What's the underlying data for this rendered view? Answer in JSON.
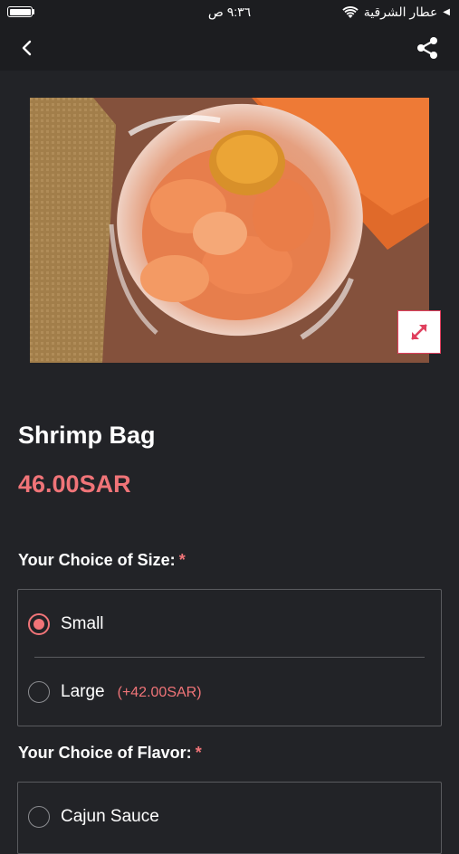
{
  "status_bar": {
    "carrier": "عطار الشرقية",
    "time": "٩:٣٦ ص"
  },
  "nav": {
    "back_icon": "chevron-left-icon",
    "share_icon": "share-icon"
  },
  "product": {
    "name": "Shrimp Bag",
    "price": "46.00SAR",
    "expand_icon": "expand-arrows-icon"
  },
  "size_section": {
    "title": "Your Choice of Size:",
    "required_mark": "*",
    "options": [
      {
        "label": "Small",
        "extra": "",
        "selected": true
      },
      {
        "label": "Large",
        "extra": "(+42.00SAR)",
        "selected": false
      }
    ]
  },
  "flavor_section": {
    "title": "Your Choice of Flavor:",
    "required_mark": "*",
    "options": [
      {
        "label": "Cajun Sauce",
        "selected": false
      }
    ]
  },
  "colors": {
    "background": "#222327",
    "accent": "#f07478",
    "border": "#5a5b5f"
  }
}
